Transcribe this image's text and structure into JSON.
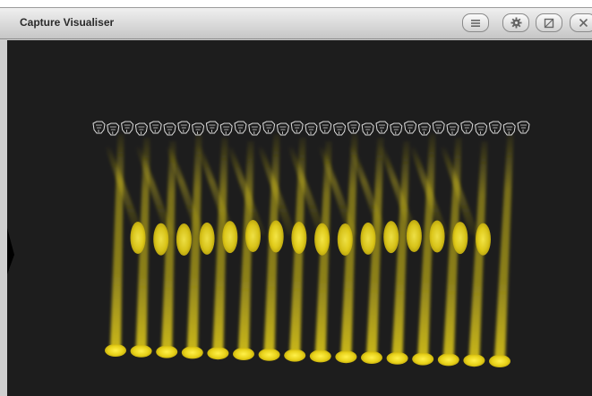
{
  "window": {
    "title": "Capture Visualiser",
    "buttons": {
      "menu": "menu-icon",
      "settings": "gear-icon",
      "restore": "restore-icon",
      "close": "close-icon"
    }
  },
  "scene": {
    "background_color": "#1d1d1d",
    "beam_color": "#e8d21a",
    "fixture_outline_color": "#dcdcdc",
    "lit_fixture_count": 16,
    "mid_spot_count": 16,
    "fixture_head_count": 31
  }
}
